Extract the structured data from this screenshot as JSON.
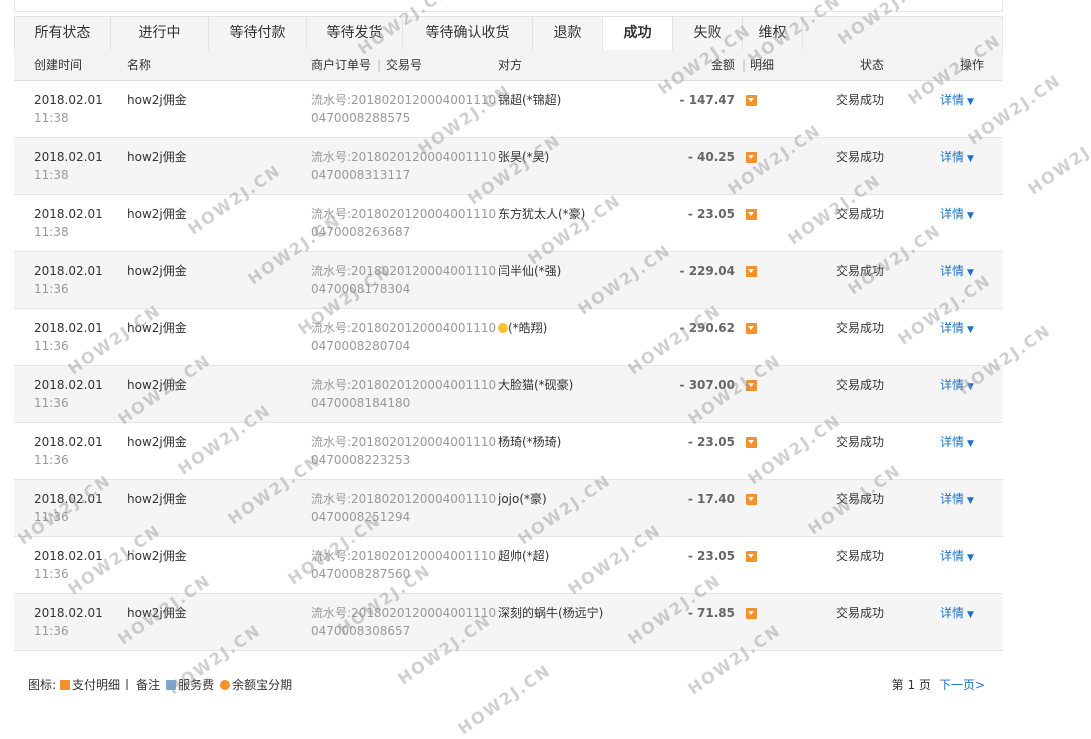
{
  "tabs": [
    {
      "label": "所有状态",
      "active": false
    },
    {
      "label": "进行中",
      "active": false
    },
    {
      "label": "等待付款",
      "active": false
    },
    {
      "label": "等待发货",
      "active": false
    },
    {
      "label": "等待确认收货",
      "active": false
    },
    {
      "label": "退款",
      "active": false
    },
    {
      "label": "成功",
      "active": true
    },
    {
      "label": "失败",
      "active": false
    },
    {
      "label": "维权",
      "active": false
    }
  ],
  "columns": {
    "created": "创建时间",
    "name": "名称",
    "order_no": "商户订单号",
    "sep": "|",
    "trade_no": "交易号",
    "party": "对方",
    "amount": "金额",
    "detail": "明细",
    "status": "状态",
    "action": "操作"
  },
  "rows": [
    {
      "date": "2018.02.01",
      "time": "11:38",
      "name": "how2j佣金",
      "serial_prefix": "流水号:2018020120004001110",
      "serial_suffix": "0470008288575",
      "party": "锦超(*锦超)",
      "amount": "- 147.47",
      "status": "交易成功",
      "action": "详情"
    },
    {
      "date": "2018.02.01",
      "time": "11:38",
      "name": "how2j佣金",
      "serial_prefix": "流水号:2018020120004001110",
      "serial_suffix": "0470008313117",
      "party": "张昊(*昊)",
      "amount": "- 40.25",
      "status": "交易成功",
      "action": "详情"
    },
    {
      "date": "2018.02.01",
      "time": "11:38",
      "name": "how2j佣金",
      "serial_prefix": "流水号:2018020120004001110",
      "serial_suffix": "0470008263687",
      "party": "东方犹太人(*豪)",
      "amount": "- 23.05",
      "status": "交易成功",
      "action": "详情"
    },
    {
      "date": "2018.02.01",
      "time": "11:36",
      "name": "how2j佣金",
      "serial_prefix": "流水号:2018020120004001110",
      "serial_suffix": "0470008178304",
      "party": "闫半仙(*强)",
      "amount": "- 229.04",
      "status": "交易成功",
      "action": "详情"
    },
    {
      "date": "2018.02.01",
      "time": "11:36",
      "name": "how2j佣金",
      "serial_prefix": "流水号:2018020120004001110",
      "serial_suffix": "0470008280704",
      "party": "(*皓翔)",
      "amount": "- 290.62",
      "status": "交易成功",
      "action": "详情",
      "emoji": true
    },
    {
      "date": "2018.02.01",
      "time": "11:36",
      "name": "how2j佣金",
      "serial_prefix": "流水号:2018020120004001110",
      "serial_suffix": "0470008184180",
      "party": "大脸猫(*砚豪)",
      "amount": "- 307.00",
      "status": "交易成功",
      "action": "详情"
    },
    {
      "date": "2018.02.01",
      "time": "11:36",
      "name": "how2j佣金",
      "serial_prefix": "流水号:2018020120004001110",
      "serial_suffix": "0470008223253",
      "party": "杨琦(*杨琦)",
      "amount": "- 23.05",
      "status": "交易成功",
      "action": "详情"
    },
    {
      "date": "2018.02.01",
      "time": "11:36",
      "name": "how2j佣金",
      "serial_prefix": "流水号:2018020120004001110",
      "serial_suffix": "0470008251294",
      "party": "jojo(*豪)",
      "amount": "- 17.40",
      "status": "交易成功",
      "action": "详情"
    },
    {
      "date": "2018.02.01",
      "time": "11:36",
      "name": "how2j佣金",
      "serial_prefix": "流水号:2018020120004001110",
      "serial_suffix": "0470008287560",
      "party": "超帅(*超)",
      "amount": "- 23.05",
      "status": "交易成功",
      "action": "详情"
    },
    {
      "date": "2018.02.01",
      "time": "11:36",
      "name": "how2j佣金",
      "serial_prefix": "流水号:2018020120004001110",
      "serial_suffix": "0470008308657",
      "party": "深刻的蜗牛(杨远宁)",
      "amount": "- 71.85",
      "status": "交易成功",
      "action": "详情"
    }
  ],
  "legend": {
    "title": "图标:",
    "pay": "支付明细",
    "note": "备注",
    "fee": "服务费",
    "yeb": "余额宝分期"
  },
  "pager": {
    "page_label": "第 1 页",
    "next_label": "下一页>"
  },
  "watermark": "HOW2J.CN",
  "colors": {
    "accent": "#1e73c8",
    "detail_icon": "#f4912b"
  }
}
